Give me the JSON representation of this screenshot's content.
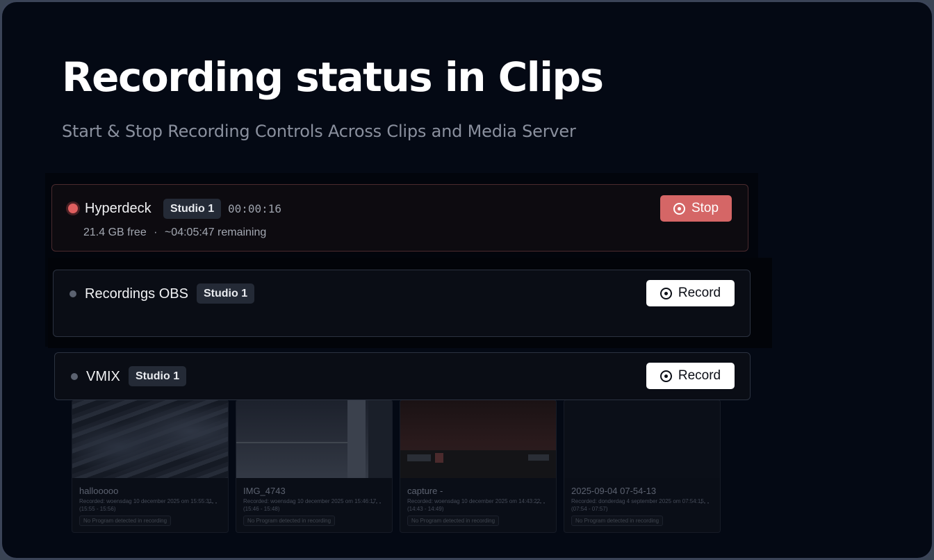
{
  "page": {
    "title": "Recording status in Clips",
    "subtitle": "Start & Stop Recording Controls Across Clips and Media Server"
  },
  "sources": [
    {
      "name": "Hyperdeck",
      "studio": "Studio 1",
      "status": "recording",
      "timer": "00:00:16",
      "free": "21.4 GB free",
      "separator": "·",
      "remaining": "~04:05:47 remaining",
      "action_label": "Stop"
    },
    {
      "name": "Recordings OBS",
      "studio": "Studio 1",
      "status": "idle",
      "action_label": "Record"
    },
    {
      "name": "VMIX",
      "studio": "Studio 1",
      "status": "idle",
      "action_label": "Record"
    }
  ],
  "clips": [
    {
      "name": "hallooooo",
      "recorded": "Recorded: woensdag 10 december 2025 om 15:55:31 (15:55 - 15:56)",
      "badge": "No Program detected in recording",
      "more": "···"
    },
    {
      "name": "IMG_4743",
      "recorded": "Recorded: woensdag 10 december 2025 om 15:46:17 (15:46 - 15:48)",
      "badge": "No Program detected in recording",
      "more": "···"
    },
    {
      "name": "capture -",
      "recorded": "Recorded: woensdag 10 december 2025 om 14:43:22 (14:43 - 14:49)",
      "badge": "No Program detected in recording",
      "more": "···"
    },
    {
      "name": "2025-09-04 07-54-13",
      "recorded": "Recorded: donderdag 4 september 2025 om 07:54:15 (07:54 - 07:57)",
      "badge": "No Program detected in recording",
      "more": "···"
    }
  ],
  "colors": {
    "background": "#040914",
    "recording_dot": "#df5f5f",
    "stop_button": "#d56666",
    "record_button": "#ffffff",
    "badge_bg": "#242a36"
  },
  "icons": {
    "record": "record-circle-icon",
    "stop": "stop-circle-icon"
  }
}
